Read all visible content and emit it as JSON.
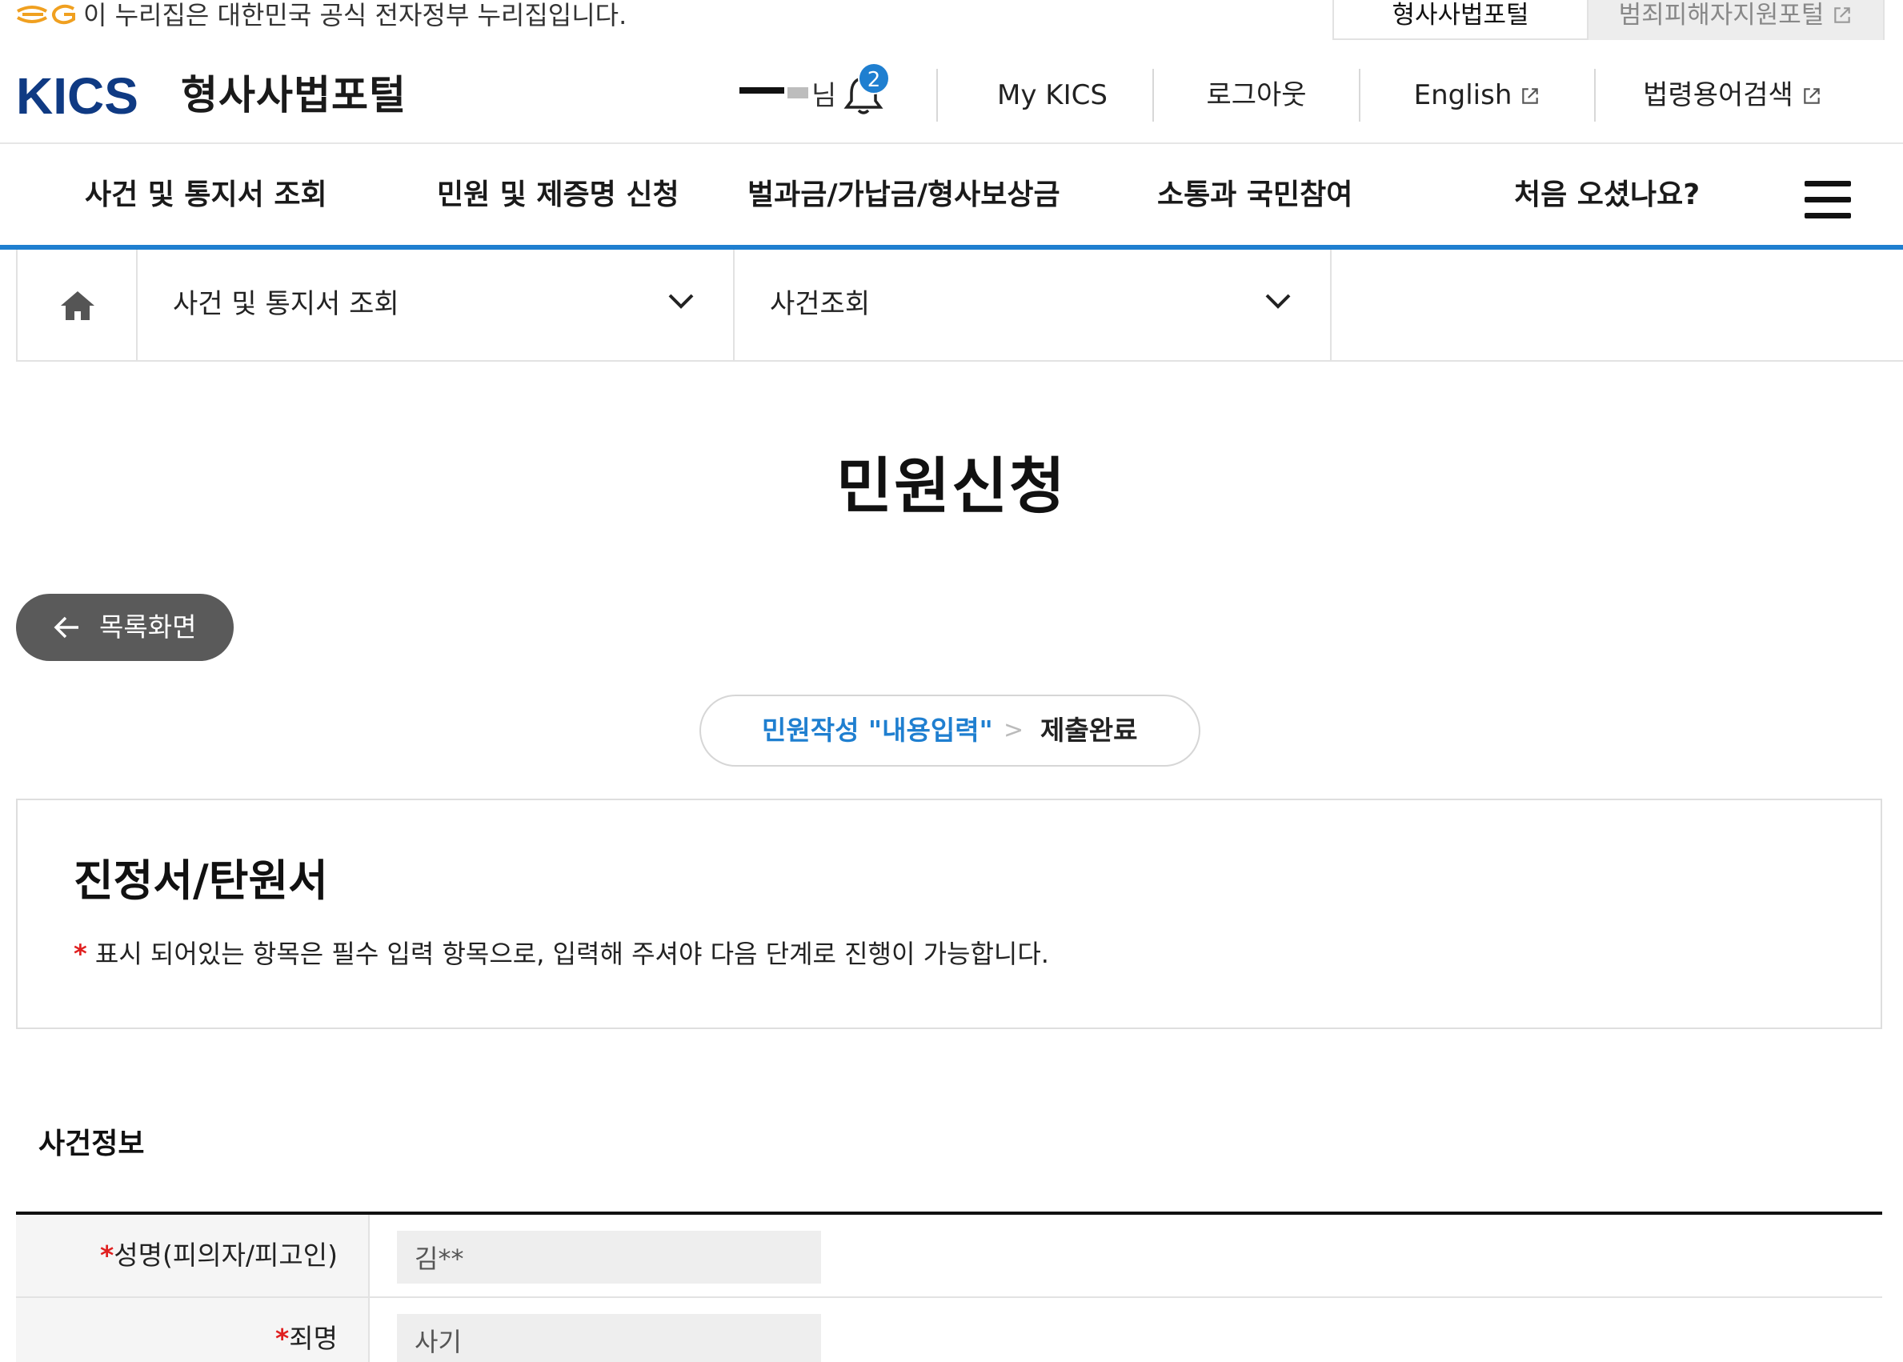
{
  "notice": {
    "text": "이 누리집은 대한민국 공식 전자정부 누리집입니다.",
    "tabs": [
      "형사사법포털",
      "범죄피해자지원포털"
    ]
  },
  "header": {
    "logo_text": "KICS",
    "portal_name": "형사사법포털",
    "user_suffix": "님",
    "notification_count": "2",
    "links": [
      "My KICS",
      "로그아웃",
      "English",
      "법령용어검색"
    ]
  },
  "nav": {
    "items": [
      "사건 및 통지서 조회",
      "민원 및 제증명 신청",
      "벌과금/가납금/형사보상금",
      "소통과 국민참여",
      "처음 오셨나요?"
    ]
  },
  "breadcrumb": {
    "level1": "사건 및 통지서 조회",
    "level2": "사건조회"
  },
  "page": {
    "title": "민원신청",
    "back_button": "목록화면"
  },
  "steps": {
    "step1": "민원작성 \"내용입력\"",
    "separator": ">",
    "step2": "제출완료"
  },
  "form": {
    "title": "진정서/탄원서",
    "required_mark": "*",
    "note": "표시 되어있는 항목은 필수 입력 항목으로, 입력해 주셔야 다음 단계로 진행이 가능합니다."
  },
  "case_info": {
    "section_title": "사건정보",
    "rows": [
      {
        "label": "성명(피의자/피고인)",
        "value": "김**",
        "required": true
      },
      {
        "label": "죄명",
        "value": "사기",
        "required": true
      }
    ]
  },
  "colors": {
    "accent": "#1f7fd0",
    "required": "#e02020",
    "back_button_bg": "#5a5a5a"
  }
}
